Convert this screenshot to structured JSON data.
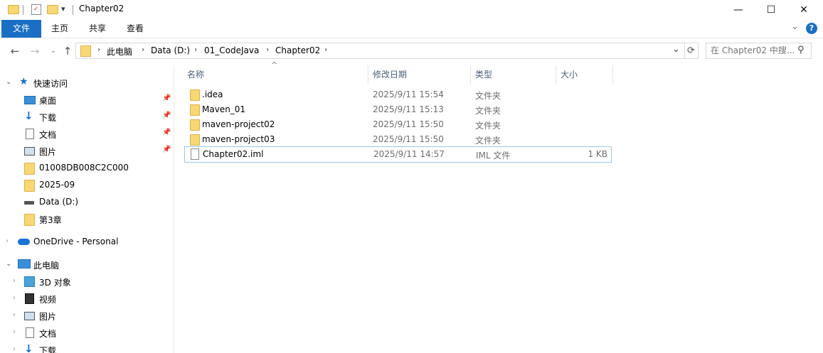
{
  "window": {
    "title": "Chapter02",
    "minimize_glyph": "—",
    "maximize_glyph": "☐",
    "close_glyph": "✕"
  },
  "quick_access_toolbar": {
    "dropdown_glyph": "▾"
  },
  "ribbon": {
    "tabs": [
      "文件",
      "主页",
      "共享",
      "查看"
    ],
    "collapse_glyph": "⌄",
    "help_glyph": "?"
  },
  "address_bar": {
    "breadcrumbs": [
      "此电脑",
      "Data (D:)",
      "01_CodeJava",
      "Chapter02"
    ],
    "separator": "›",
    "dropdown_glyph": "⌄",
    "refresh_glyph": "⟳"
  },
  "search": {
    "placeholder": "在 Chapter02 中搜..."
  },
  "nav_pane": {
    "quick_access_label": "快速访问",
    "quick_access_items": [
      {
        "label": "桌面",
        "pinned": true
      },
      {
        "label": "下载",
        "pinned": true
      },
      {
        "label": "文档",
        "pinned": true
      },
      {
        "label": "图片",
        "pinned": true
      },
      {
        "label": "01008DB008C2C000",
        "pinned": false
      },
      {
        "label": "2025-09",
        "pinned": false
      },
      {
        "label": "Data (D:)",
        "pinned": false
      },
      {
        "label": "第3章",
        "pinned": false
      }
    ],
    "onedrive_label": "OneDrive - Personal",
    "this_pc_label": "此电脑",
    "this_pc_items": [
      "3D 对象",
      "视频",
      "图片",
      "文档",
      "下载"
    ]
  },
  "file_list": {
    "columns": [
      "名称",
      "修改日期",
      "类型",
      "大小"
    ],
    "sort_indicator": "^",
    "rows": [
      {
        "name": ".idea",
        "date": "2025/9/11 15:54",
        "type": "文件夹",
        "size": "",
        "kind": "folder"
      },
      {
        "name": "Maven_01",
        "date": "2025/9/11 15:13",
        "type": "文件夹",
        "size": "",
        "kind": "folder"
      },
      {
        "name": "maven-project02",
        "date": "2025/9/11 15:50",
        "type": "文件夹",
        "size": "",
        "kind": "folder"
      },
      {
        "name": "maven-project03",
        "date": "2025/9/11 15:50",
        "type": "文件夹",
        "size": "",
        "kind": "folder"
      },
      {
        "name": "Chapter02.iml",
        "date": "2025/9/11 14:57",
        "type": "IML 文件",
        "size": "1 KB",
        "kind": "file"
      }
    ]
  },
  "colors": {
    "file_tab_bg": "#1a6fc5",
    "folder_yellow": "#f8d775",
    "selection_border": "#99c9ef",
    "header_text": "#4c607a"
  }
}
